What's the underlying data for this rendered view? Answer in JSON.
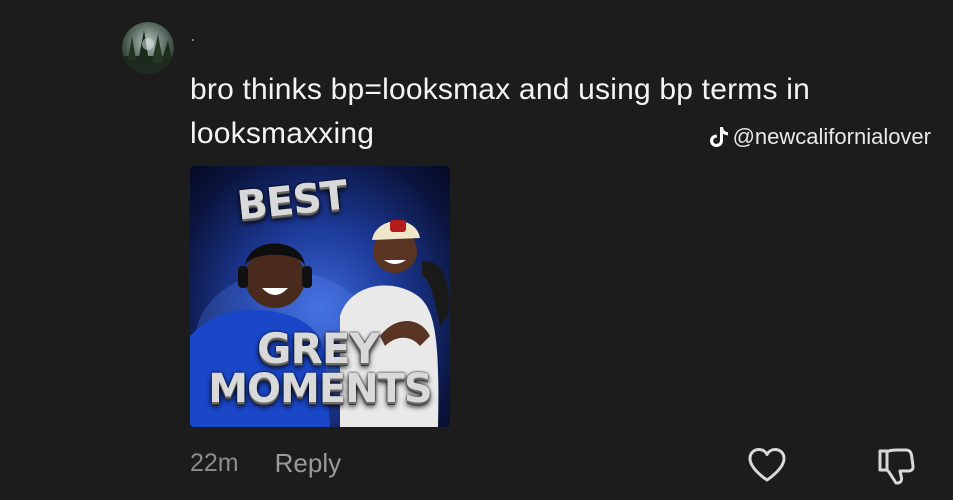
{
  "comment": {
    "username": "·",
    "text": "bro thinks bp=looksmax and using bp terms in looksmaxxing",
    "time": "22m",
    "reply_label": "Reply"
  },
  "watermark": {
    "icon": "tiktok-icon",
    "handle": "@newcalifornialover"
  },
  "thumbnail": {
    "line1": "BEST",
    "line2": "GREY",
    "line3": "MOMENTS"
  },
  "icons": {
    "like": "heart-icon",
    "dislike": "thumbs-down-icon"
  },
  "colors": {
    "background": "#1c1c1c",
    "text": "#f4f4f4",
    "muted": "#8c8c8c"
  }
}
